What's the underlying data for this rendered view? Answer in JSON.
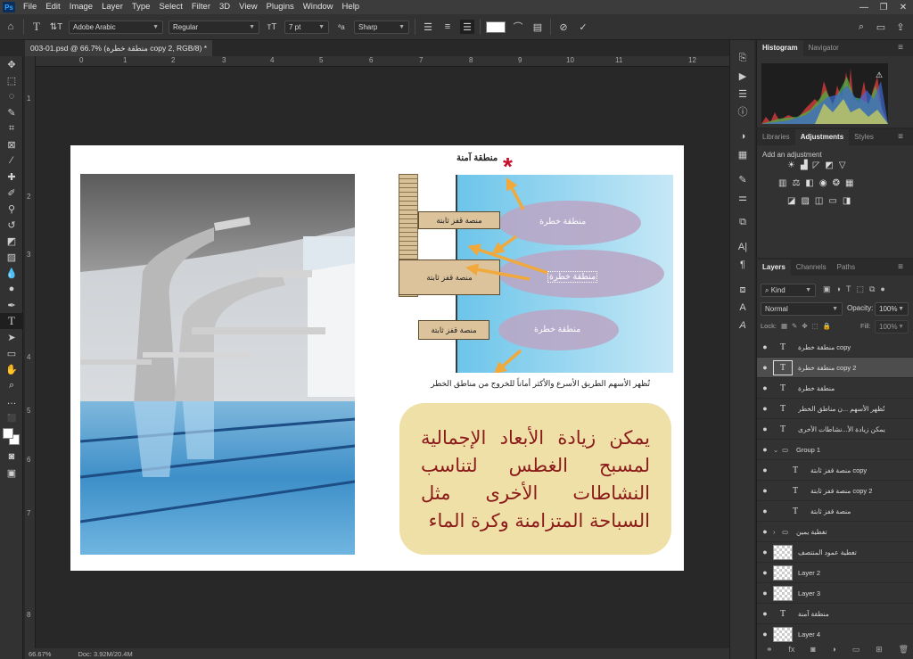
{
  "app": {
    "logo": "Ps"
  },
  "menu": [
    "File",
    "Edit",
    "Image",
    "Layer",
    "Type",
    "Select",
    "Filter",
    "3D",
    "View",
    "Plugins",
    "Window",
    "Help"
  ],
  "options": {
    "font_family": "Adobe Arabic",
    "font_style": "Regular",
    "font_size": "7 pt",
    "aa_label": "ªa",
    "antialias": "Sharp"
  },
  "document": {
    "tab_title": "003-01.psd @ 66.7% (منطقة خطرة copy 2, RGB/8) *",
    "close": "×"
  },
  "ruler": {
    "h": [
      "0",
      "1",
      "2",
      "3",
      "4",
      "5",
      "6",
      "7",
      "8",
      "9",
      "10",
      "11",
      "12"
    ],
    "v": [
      "1",
      "2",
      "3",
      "4",
      "5",
      "6",
      "7",
      "8"
    ]
  },
  "artwork": {
    "safe_zone": "منطقة آمنة",
    "star": "*",
    "platform_1": "منصة قفز ثابتة",
    "platform_2": "منصة قفز ثابتة",
    "platform_3": "منصة قفز ثابتة",
    "danger_1": "منطقة خطرة",
    "danger_2": "منطقة خطرة",
    "danger_3": "منطقة خطرة",
    "caption": "تُظهر الأسهم الطريق الأسرع والأكثر أماناً للخروج من مناطق الخطر",
    "box_text": "يمكن زيادة الأبعاد الإجمالية لمسبح الغطس لتناسب النشاطات الأخرى مثل السباحة المتزامنة وكرة الماء"
  },
  "status": {
    "zoom": "66.67%",
    "doc": "Doc: 3.92M/20.4M"
  },
  "panels": {
    "histogram_tabs": [
      "Histogram",
      "Navigator"
    ],
    "adjust_tabs": [
      "Libraries",
      "Adjustments",
      "Styles"
    ],
    "add_adjustment": "Add an adjustment",
    "layers_tabs": [
      "Layers",
      "Channels",
      "Paths"
    ],
    "kind": "Kind",
    "blend_mode": "Normal",
    "opacity_label": "Opacity:",
    "opacity": "100%",
    "lock_label": "Lock:",
    "fill_label": "Fill:",
    "fill": "100%"
  },
  "layers": [
    {
      "name": "منطقة خطرة copy",
      "kind": "text",
      "indent": 0,
      "selected": false
    },
    {
      "name": "منطقة خطرة copy 2",
      "kind": "text",
      "indent": 0,
      "selected": true
    },
    {
      "name": "منطقة خطرة",
      "kind": "text",
      "indent": 0,
      "selected": false
    },
    {
      "name": "تُظهر الأسهم ...ن مناطق الخطر",
      "kind": "text",
      "indent": 0,
      "selected": false
    },
    {
      "name": "يمكن زيادة الأ...نشاطات الأخرى",
      "kind": "text",
      "indent": 0,
      "selected": false
    },
    {
      "name": "Group 1",
      "kind": "group-open",
      "indent": 0,
      "selected": false
    },
    {
      "name": "منصة قفز ثابتة copy",
      "kind": "text",
      "indent": 1,
      "selected": false
    },
    {
      "name": "منصة قفز ثابتة copy 2",
      "kind": "text",
      "indent": 1,
      "selected": false
    },
    {
      "name": "منصة قفز ثابتة",
      "kind": "text",
      "indent": 1,
      "selected": false
    },
    {
      "name": "تغطية يمين",
      "kind": "group-closed",
      "indent": 0,
      "selected": false
    },
    {
      "name": "تغطية عمود المنتصف",
      "kind": "pixel",
      "indent": 0,
      "selected": false
    },
    {
      "name": "Layer 2",
      "kind": "pixel",
      "indent": 0,
      "selected": false
    },
    {
      "name": "Layer 3",
      "kind": "pixel",
      "indent": 0,
      "selected": false
    },
    {
      "name": "منطقة آمنة",
      "kind": "text",
      "indent": 0,
      "selected": false
    },
    {
      "name": "Layer 4",
      "kind": "pixel",
      "indent": 0,
      "selected": false
    }
  ],
  "colors": {
    "accent": "#31a8ff",
    "pool_blue": "#a8dcf3",
    "platform_tan": "#dcc39b",
    "danger_ellipse": "#b9a7c6",
    "arrow": "#f2a93b",
    "box_fill": "#efe0a8",
    "box_text": "#8b1a1a",
    "star": "#c8102e"
  }
}
